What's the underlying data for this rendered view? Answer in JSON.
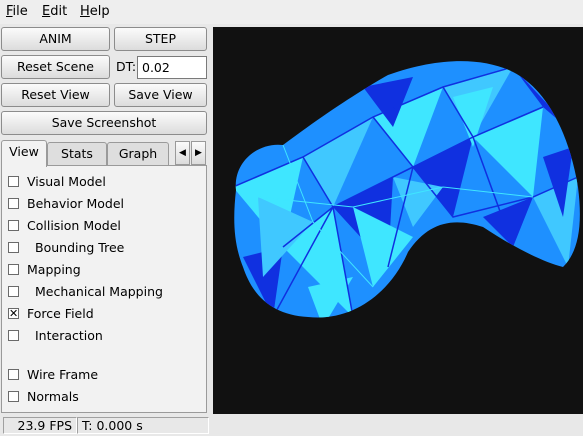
{
  "menubar": {
    "file": "File",
    "edit": "Edit",
    "help": "Help"
  },
  "toolbar": {
    "anim": "ANIM",
    "step": "STEP",
    "reset_scene": "Reset Scene",
    "dt_label": "DT:",
    "dt_value": "0.02",
    "reset_view": "Reset View",
    "save_view": "Save View",
    "save_screenshot": "Save Screenshot"
  },
  "tabs": [
    "View",
    "Stats",
    "Graph"
  ],
  "view_options": [
    {
      "label": "Visual Model",
      "checked": false
    },
    {
      "label": "Behavior Model",
      "checked": false
    },
    {
      "label": "Collision Model",
      "checked": false
    },
    {
      "label": "Bounding Tree",
      "checked": false
    },
    {
      "label": "Mapping",
      "checked": false
    },
    {
      "label": "Mechanical Mapping",
      "checked": false
    },
    {
      "label": "Force Field",
      "checked": true
    },
    {
      "label": "Interaction",
      "checked": false
    },
    {
      "label": "Wire Frame",
      "checked": false
    },
    {
      "label": "Normals",
      "checked": false
    }
  ],
  "status": {
    "fps": "23.9 FPS",
    "time": "T: 0.000 s"
  },
  "colors": {
    "viewport_bg": "#111111",
    "mesh_light": "#3fe6ff",
    "mesh_mid": "#1e90ff",
    "mesh_dark": "#1030e0"
  }
}
